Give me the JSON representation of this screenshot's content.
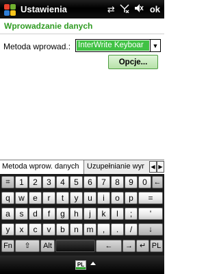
{
  "titlebar": {
    "title": "Ustawienia",
    "icons": [
      "start-icon",
      "connectivity-icon",
      "signal-off-icon",
      "volume-mute-icon"
    ],
    "ok_label": "ok"
  },
  "page": {
    "header": "Wprowadzanie danych"
  },
  "form": {
    "method_label": "Metoda wprowad.:",
    "method_value": "InterWrite Keyboar",
    "options_button": "Opcje..."
  },
  "tabs": {
    "items": [
      {
        "label": "Metoda wprow. danych",
        "active": true
      },
      {
        "label": "Uzupełnianie wyr",
        "active": false
      }
    ],
    "scroll_left": "◀",
    "scroll_right": "▶"
  },
  "keyboard": {
    "rows": [
      [
        "⌗",
        "1",
        "2",
        "3",
        "4",
        "5",
        "6",
        "7",
        "8",
        "9",
        "0",
        "←"
      ],
      [
        "q",
        "w",
        "e",
        "r",
        "t",
        "y",
        "u",
        "i",
        "o",
        "p",
        "="
      ],
      [
        "a",
        "s",
        "d",
        "f",
        "g",
        "h",
        "j",
        "k",
        "l",
        ";",
        "'"
      ],
      [
        "y",
        "x",
        "c",
        "v",
        "b",
        "n",
        "m",
        ",",
        ".",
        "/",
        "↓"
      ],
      [
        "Fn",
        "⇧",
        "Alt",
        "",
        "←",
        "→",
        "↵",
        "PL"
      ]
    ]
  },
  "menubar": {
    "language": "PL"
  },
  "colors": {
    "accent_green": "#40c244",
    "header_green": "#2f9b22",
    "titlebar_bg": "#000000"
  }
}
